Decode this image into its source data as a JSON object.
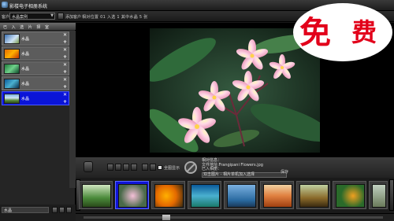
{
  "window": {
    "title": "影楼电子相册系统"
  },
  "toolbar": {
    "album_label": "客户",
    "album_select": "水晶案例",
    "add_label": "添加客户",
    "stats": "相对位置 01  入选 1  其中水晶 5  张"
  },
  "sidebar": {
    "header": "已 入 选 片 择 室",
    "albums": [
      {
        "name": "水晶"
      },
      {
        "name": "水晶"
      },
      {
        "name": "水晶"
      },
      {
        "name": "水晶"
      },
      {
        "name": "水晶"
      }
    ],
    "footer_input": "水晶"
  },
  "controls": {
    "zoom_label": "全图显示",
    "info_title": "相对信息：",
    "info_file": "文件地址:Frangipani Flowers.jpg",
    "info_sel": "已入相册：",
    "info_desc": "双击图片 - 相片单机加入选择",
    "save_label": "保存"
  },
  "filmstrip": {
    "selected_index": 1,
    "count": 9
  },
  "stamp": {
    "text1": "免",
    "text2": "费"
  }
}
